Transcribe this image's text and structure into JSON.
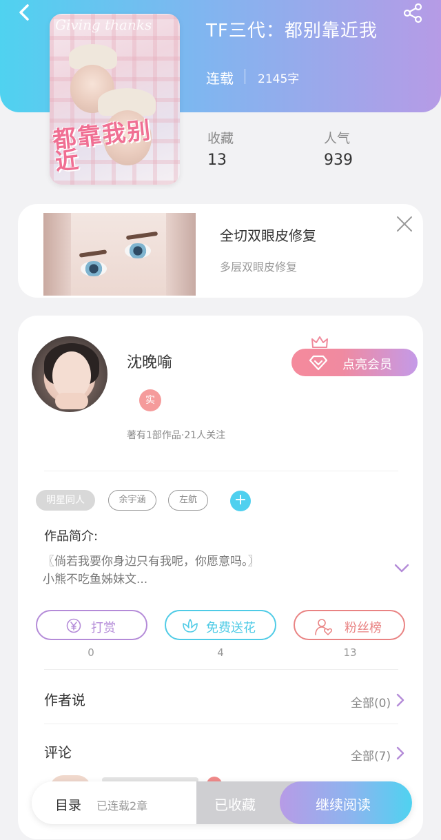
{
  "header": {
    "back_icon": "chevron-left-icon",
    "share_icon": "share-icon",
    "title": "TF三代：都别靠近我",
    "status": "连载",
    "word_count": "2145字",
    "cover": {
      "watermark": "Giving thanks",
      "title": "都靠我别近"
    }
  },
  "stats": {
    "favorites_label": "收藏",
    "favorites_value": "13",
    "popularity_label": "人气",
    "popularity_value": "939"
  },
  "ad": {
    "title": "全切双眼皮修复",
    "subtitle": "多层双眼皮修复",
    "close_icon": "close-icon"
  },
  "author": {
    "name": "沈晚喻",
    "badge": "实",
    "meta": "著有1部作品·21人关注",
    "vip_label": "点亮会员",
    "vip_icon": "diamond-icon",
    "crown_icon": "crown-icon"
  },
  "tags": {
    "items": [
      "明星同人",
      "余宇涵",
      "左航"
    ],
    "add_label": "+"
  },
  "intro": {
    "label": "作品简介:",
    "line1": "〖倘若我要你身边只有我呢，你愿意吗。〗",
    "line2": "小熊不吃鱼姊妹文..."
  },
  "actions": {
    "reward_label": "打赏",
    "reward_count": "0",
    "flower_label": "免费送花",
    "flower_count": "4",
    "fans_label": "粉丝榜",
    "fans_count": "13"
  },
  "sections": {
    "author_says": "作者说",
    "author_says_all": "全部(0)",
    "comments": "评论",
    "comments_all": "全部(7)"
  },
  "bottom_bar": {
    "toc": "目录",
    "chapters": "已连载2章",
    "collected": "已收藏",
    "read": "继续阅读"
  },
  "colors": {
    "accent_cyan": "#4fd2f0",
    "accent_purple": "#b69be6",
    "vip_pink": "#f58a9c",
    "reward_purple": "#b48bd8",
    "flower_cyan": "#4fcbe6",
    "fans_red": "#e98383"
  }
}
